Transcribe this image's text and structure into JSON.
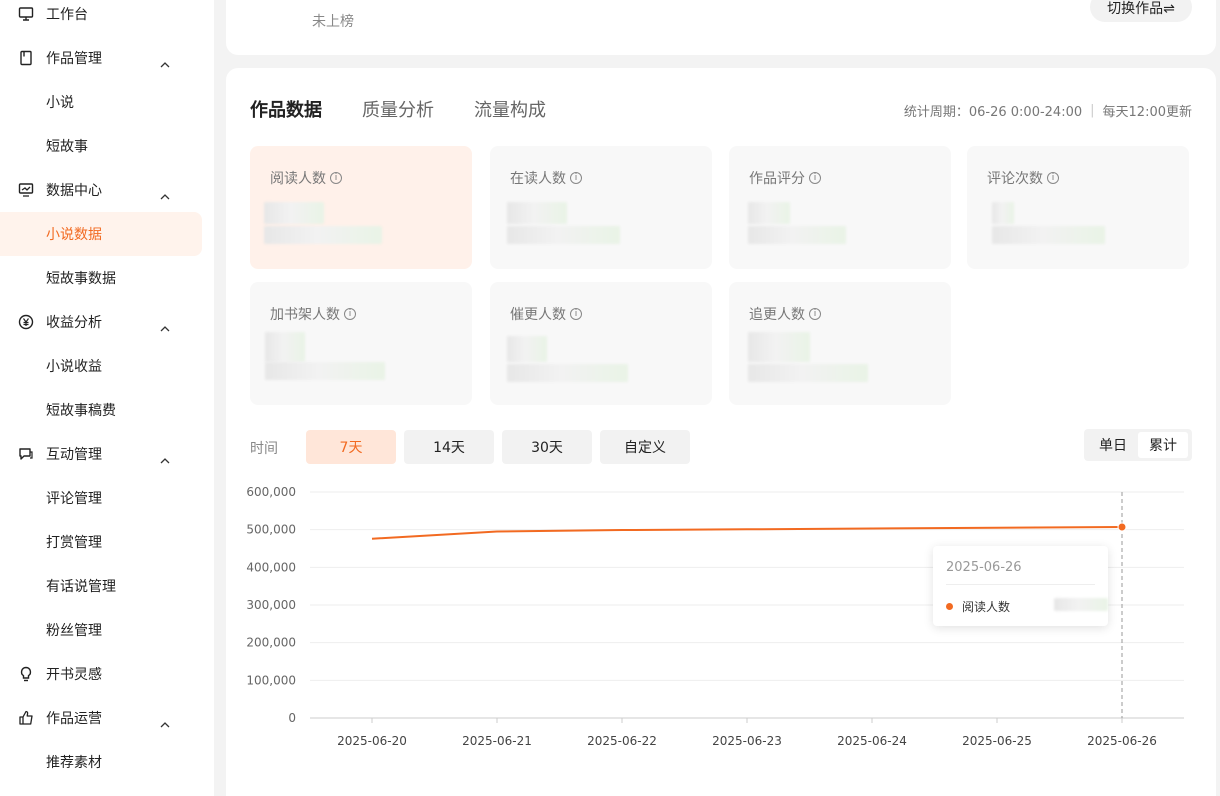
{
  "sidebar": {
    "items": [
      {
        "label": "工作台",
        "icon": "monitor-icon",
        "top": 0
      },
      {
        "label": "作品管理",
        "icon": "book-icon",
        "expanded": true
      },
      {
        "label": "小说",
        "sub": true
      },
      {
        "label": "短故事",
        "sub": true
      },
      {
        "label": "数据中心",
        "icon": "chart-monitor-icon",
        "expanded": true
      },
      {
        "label": "小说数据",
        "sub": true,
        "active": true
      },
      {
        "label": "短故事数据",
        "sub": true
      },
      {
        "label": "收益分析",
        "icon": "yen-icon",
        "expanded": true
      },
      {
        "label": "小说收益",
        "sub": true
      },
      {
        "label": "短故事稿费",
        "sub": true
      },
      {
        "label": "互动管理",
        "icon": "chat-icon",
        "expanded": true
      },
      {
        "label": "评论管理",
        "sub": true
      },
      {
        "label": "打赏管理",
        "sub": true
      },
      {
        "label": "有话说管理",
        "sub": true
      },
      {
        "label": "粉丝管理",
        "sub": true
      },
      {
        "label": "开书灵感",
        "icon": "bulb-icon"
      },
      {
        "label": "作品运营",
        "icon": "thumb-icon",
        "expanded": true
      },
      {
        "label": "推荐素材",
        "sub": true
      }
    ]
  },
  "top": {
    "status": "未上榜",
    "switch_label": "切换作品⇌"
  },
  "tabs": [
    {
      "label": "作品数据",
      "active": true
    },
    {
      "label": "质量分析"
    },
    {
      "label": "流量构成"
    }
  ],
  "period": {
    "range": "统计周期：06-26 0:00-24:00",
    "update": "每天12:00更新"
  },
  "metrics": [
    {
      "label": "阅读人数",
      "highlight": true
    },
    {
      "label": "在读人数"
    },
    {
      "label": "作品评分"
    },
    {
      "label": "评论次数"
    },
    {
      "label": "加书架人数"
    },
    {
      "label": "催更人数"
    },
    {
      "label": "追更人数"
    }
  ],
  "filters": {
    "time_label": "时间",
    "ranges": [
      {
        "label": "7天",
        "active": true
      },
      {
        "label": "14天"
      },
      {
        "label": "30天"
      },
      {
        "label": "自定义"
      }
    ],
    "modes": [
      {
        "label": "单日"
      },
      {
        "label": "累计",
        "active": true
      }
    ]
  },
  "tooltip": {
    "date": "2025-06-26",
    "series_name": "阅读人数"
  },
  "chart_data": {
    "type": "line",
    "x": [
      "2025-06-20",
      "2025-06-21",
      "2025-06-22",
      "2025-06-23",
      "2025-06-24",
      "2025-06-25",
      "2025-06-26"
    ],
    "series": [
      {
        "name": "阅读人数",
        "values": [
          476000,
          495000,
          499000,
          501000,
          503000,
          505000,
          507000
        ]
      }
    ],
    "yticks": [
      0,
      100000,
      200000,
      300000,
      400000,
      500000,
      600000
    ],
    "ytick_labels": [
      "0",
      "100,000",
      "200,000",
      "300,000",
      "400,000",
      "500,000",
      "600,000"
    ],
    "ylim": [
      0,
      600000
    ],
    "grid": true,
    "color": "#f26a21",
    "highlight_index": 6
  },
  "colors": {
    "accent": "#f26a21",
    "accent_bg": "#fff3ec"
  }
}
